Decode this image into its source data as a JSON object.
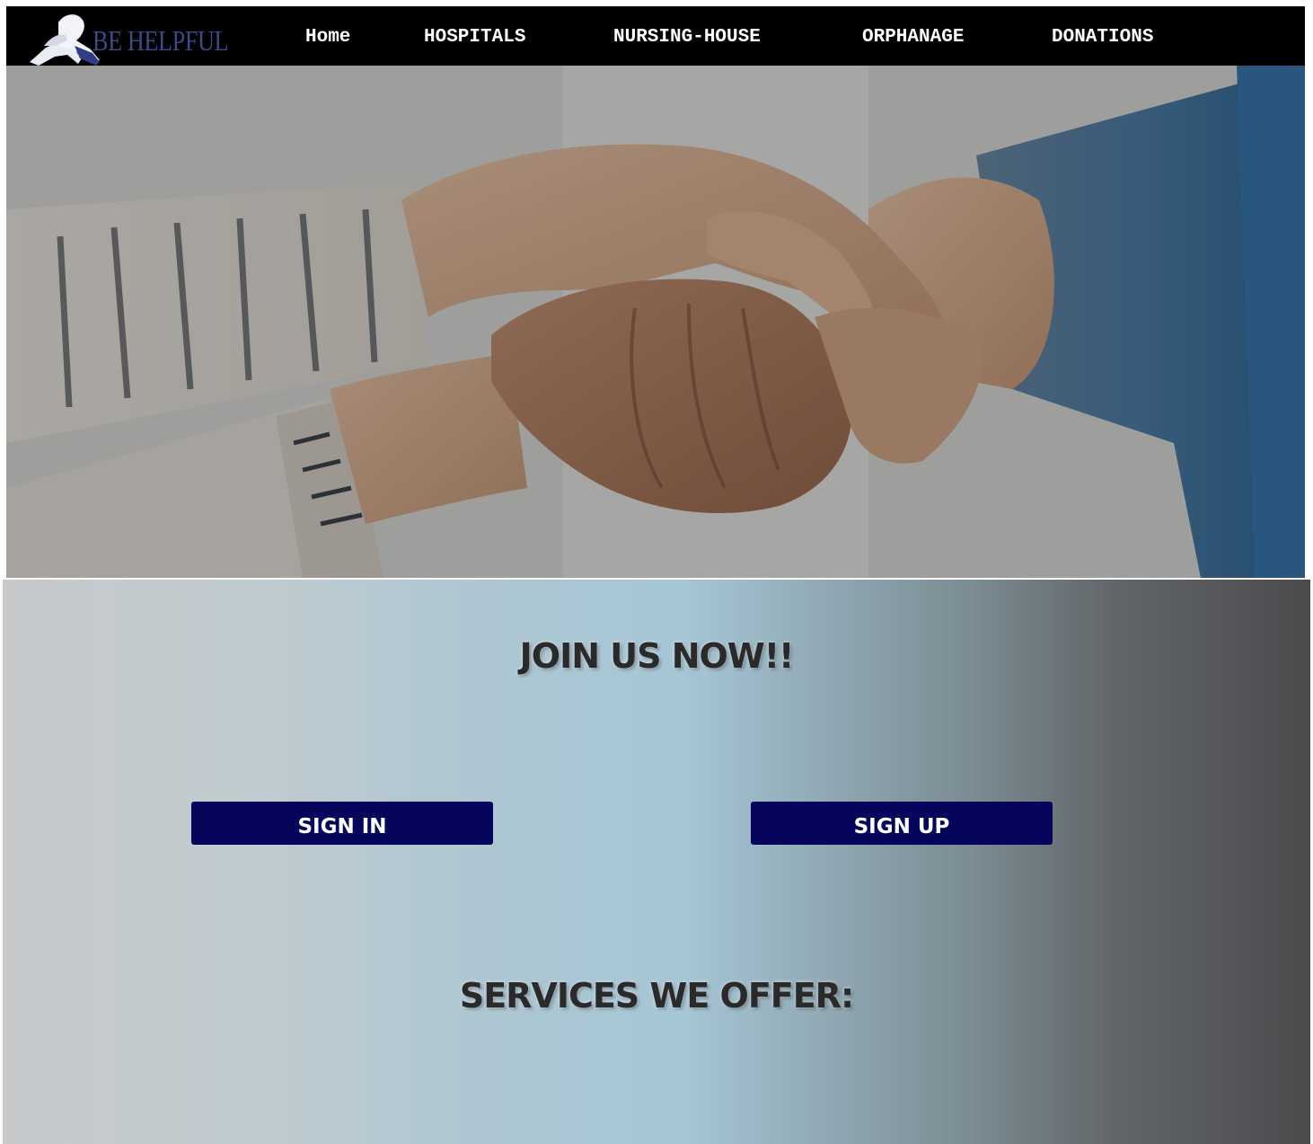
{
  "brand": {
    "name": "BE HELPFUL",
    "logo_icon": "handshake-icon",
    "logo_color": "#3c4a8a"
  },
  "nav": {
    "items": [
      {
        "label": "Home"
      },
      {
        "label": "HOSPITALS"
      },
      {
        "label": "NURSING-HOUSE"
      },
      {
        "label": "ORPHANAGE"
      },
      {
        "label": "DONATIONS"
      }
    ]
  },
  "hero": {
    "image": "holding-hands-photo"
  },
  "join": {
    "title": "JOIN US NOW!!",
    "sign_in_label": "SIGN IN",
    "sign_up_label": "SIGN UP",
    "button_color": "#04055b"
  },
  "services": {
    "title": "SERVICES WE OFFER:"
  }
}
